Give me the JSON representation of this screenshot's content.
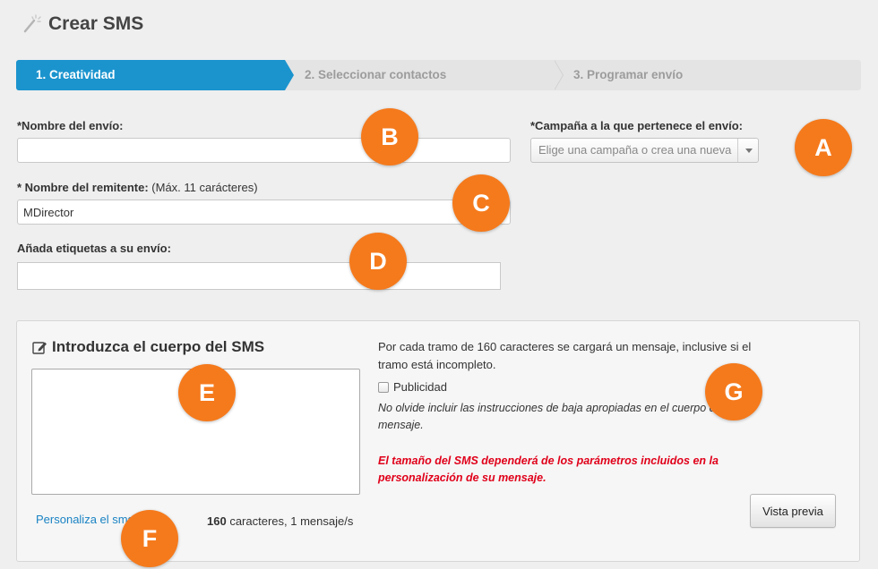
{
  "header": {
    "title": "Crear SMS",
    "icon": "magic-wand-icon"
  },
  "steps": [
    {
      "label": "1. Creatividad",
      "active": true
    },
    {
      "label": "2. Seleccionar contactos",
      "active": false
    },
    {
      "label": "3. Programar envío",
      "active": false
    }
  ],
  "form": {
    "name_label": "*Nombre del envío:",
    "name_value": "",
    "campaign_label": "*Campaña a la que pertenece el envío:",
    "campaign_placeholder": "Elige una campaña o crea una nueva",
    "sender_label_bold": "* Nombre del remitente:",
    "sender_label_hint": "(Máx. 11 carácteres)",
    "sender_value": "MDirector",
    "tags_label": "Añada etiquetas a su envío:",
    "tags_value": ""
  },
  "sms_panel": {
    "title": "Introduzca el cuerpo del SMS",
    "title_icon": "edit-icon",
    "body_value": "",
    "personalize_link": "Personaliza el sms",
    "char_count": "160",
    "counter_suffix": "caracteres, 1 mensaje/s",
    "info": "Por cada tramo de 160 caracteres se cargará un mensaje, inclusive si el tramo está incompleto.",
    "checkbox_label": "Publicidad",
    "checkbox_checked": false,
    "note": "No olvide incluir las instrucciones de baja apropiadas en el cuerpo de su mensaje.",
    "warning": "El tamaño del SMS dependerá de los parámetros incluidos en la personalización de su mensaje.",
    "preview_button": "Vista previa"
  },
  "markers": {
    "a": "A",
    "b": "B",
    "c": "C",
    "d": "D",
    "e": "E",
    "f": "F",
    "g": "G"
  },
  "colors": {
    "accent": "#1b94ce",
    "marker": "#f57a1c",
    "warning": "#e0001a",
    "link": "#1a83c4"
  }
}
